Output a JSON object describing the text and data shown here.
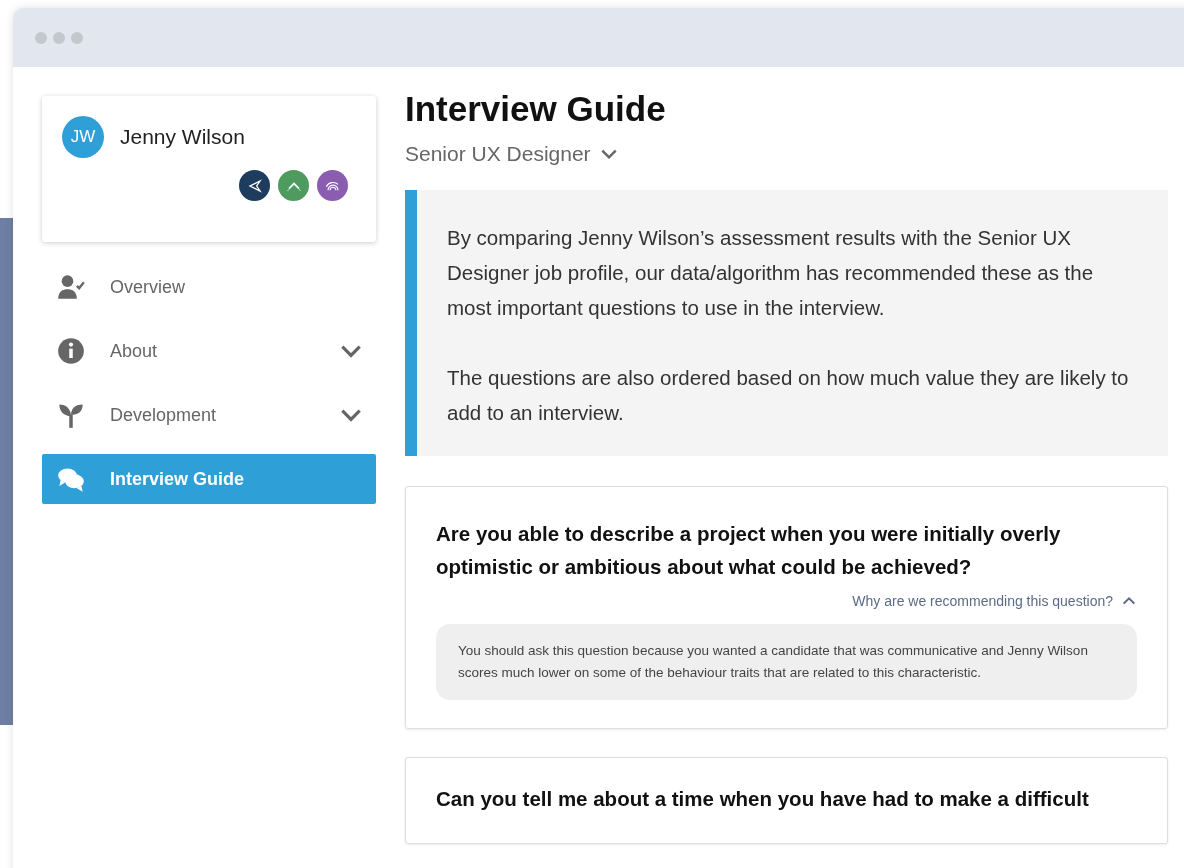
{
  "profile": {
    "initials": "JW",
    "name": "Jenny Wilson",
    "badges": [
      {
        "kind": "send",
        "color": "#1d3c5e"
      },
      {
        "kind": "chevron",
        "color": "#4f9a5e"
      },
      {
        "kind": "signal",
        "color": "#8a5db0"
      }
    ]
  },
  "sidebar": {
    "items": [
      {
        "kind": "person",
        "label": "Overview",
        "selected": false
      },
      {
        "kind": "info",
        "label": "About",
        "selected": false,
        "expanded": false
      },
      {
        "kind": "sprout",
        "label": "Development",
        "selected": false,
        "expanded": false
      },
      {
        "kind": "chat",
        "label": "Interview Guide",
        "selected": true
      }
    ]
  },
  "page": {
    "title": "Interview Guide",
    "role": "Senior UX Designer"
  },
  "intro": [
    "By comparing Jenny Wilson’s assessment results with the Senior UX Designer job profile, our data/algorithm has recommended these as the most important questions to use in the interview.",
    "The questions are also ordered based on how much value they are likely to add to an interview."
  ],
  "questions": [
    {
      "text": "Are you able to describe a project when you were initially overly optimistic or ambitious about what could be achieved?",
      "toggle": "Why are we recommending this question?",
      "expanded": true,
      "reason": "You should ask this question because you wanted a candidate that was communicative and Jenny Wilson scores much lower on some of the behaviour traits that are related to this characteristic."
    },
    {
      "text": "Can you tell me about a time when you have had to make a difficult"
    }
  ]
}
